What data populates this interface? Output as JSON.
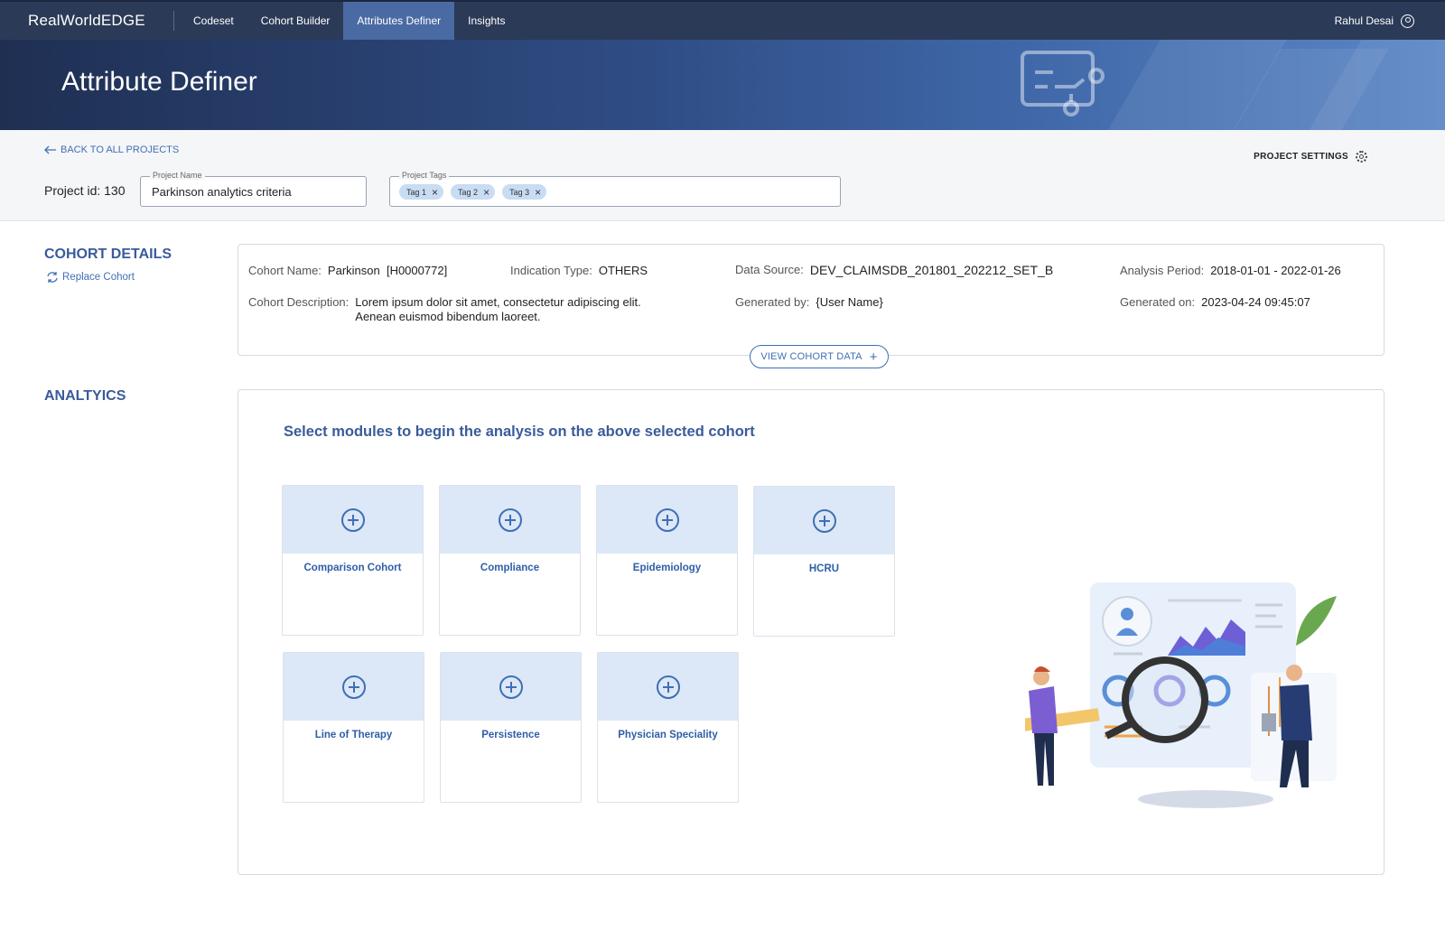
{
  "nav": {
    "brand": "RealWorldEDGE",
    "items": [
      {
        "label": "Codeset"
      },
      {
        "label": "Cohort Builder"
      },
      {
        "label": "Attributes Definer"
      },
      {
        "label": "Insights"
      }
    ],
    "active_index": 2,
    "user_name": "Rahul Desai"
  },
  "banner": {
    "title": "Attribute Definer"
  },
  "project": {
    "back_label": "BACK TO ALL PROJECTS",
    "id_label": "Project id: 130",
    "name_legend": "Project Name",
    "name_value": "Parkinson analytics criteria",
    "tags_legend": "Project Tags",
    "tags": [
      "Tag 1",
      "Tag 2",
      "Tag 3"
    ],
    "settings_label": "PROJECT SETTINGS"
  },
  "cohort": {
    "section_title": "COHORT DETAILS",
    "replace_label": "Replace Cohort",
    "name_key": "Cohort Name:",
    "name_value": "Parkinson  [H0000772]",
    "indication_key": "Indication Type:",
    "indication_value": "OTHERS",
    "source_key": "Data Source:",
    "source_value": "DEV_CLAIMSDB_201801_202212_SET_B",
    "period_key": "Analysis Period:",
    "period_value": "2018-01-01 - 2022-01-26",
    "desc_key": "Cohort Description:",
    "desc_line1": "Lorem ipsum dolor sit amet, consectetur adipiscing elit.",
    "desc_line2": "Aenean euismod bibendum laoreet.",
    "generated_by_key": "Generated by:",
    "generated_by_value": "{User Name}",
    "generated_on_key": "Generated on:",
    "generated_on_value": "2023-04-24 09:45:07",
    "view_button": "VIEW COHORT DATA"
  },
  "analytics": {
    "section_title": "ANALTYICS",
    "subtitle": "Select modules to begin the analysis on the above selected cohort",
    "modules": [
      {
        "label": "Comparison Cohort"
      },
      {
        "label": "Compliance"
      },
      {
        "label": "Epidemiology"
      },
      {
        "label": "HCRU"
      },
      {
        "label": "Line of Therapy"
      },
      {
        "label": "Persistence"
      },
      {
        "label": "Physician Speciality"
      }
    ]
  },
  "colors": {
    "nav_bg": "#2b3a57",
    "nav_active": "#4a6aa3",
    "accent": "#3f6fb5",
    "heading": "#3a5b9a",
    "module_top": "#dce8f7"
  },
  "icons": [
    "user-circle-icon",
    "arrow-left-icon",
    "gear-icon",
    "refresh-icon",
    "plus-icon",
    "plus-circle-icon",
    "tag-close-icon"
  ]
}
